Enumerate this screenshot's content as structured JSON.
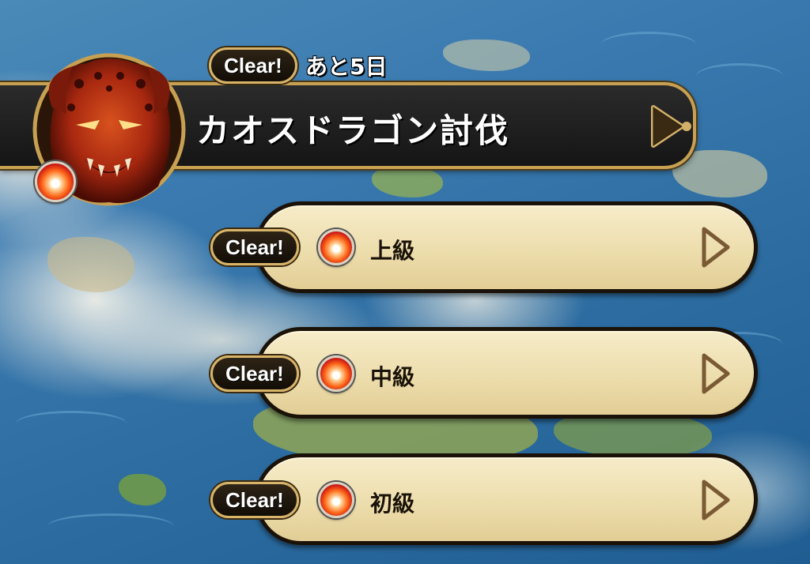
{
  "event": {
    "title": "カオスドラゴン討伐",
    "status_badge": "Clear!",
    "deadline": "あと5日",
    "element_icon": "fire-orb-icon",
    "boss_icon": "chaos-dragon-portrait"
  },
  "difficulties": [
    {
      "label": "上級",
      "status_badge": "Clear!",
      "element_icon": "fire-orb-icon"
    },
    {
      "label": "中級",
      "status_badge": "Clear!",
      "element_icon": "fire-orb-icon"
    },
    {
      "label": "初級",
      "status_badge": "Clear!",
      "element_icon": "fire-orb-icon"
    }
  ],
  "colors": {
    "banner_bg": "#1a1a1a",
    "gold_border": "#c7a052",
    "row_bg": "#ecdcaa",
    "badge_bg": "#1e160b"
  }
}
